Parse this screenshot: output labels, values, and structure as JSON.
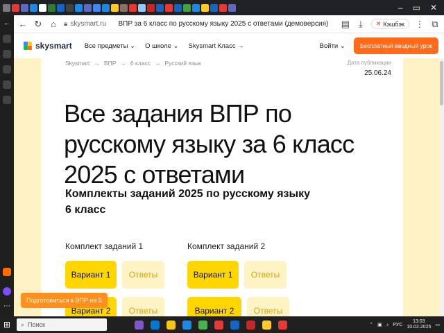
{
  "browser": {
    "url": "skysmart.ru",
    "tab_title": "ВПР за 6 класс по русскому языку 2025 с ответами (демоверсия)",
    "extension_badge": "Кэшбэк",
    "favicon_colors": [
      "#7a7a7a",
      "#e53935",
      "#5c6bc0",
      "#1e88e5",
      "#ffffff",
      "#2e7d32",
      "#1565c0",
      "#424242",
      "#1e88e5",
      "#5c6bc0",
      "#4285f4",
      "#1e88e5",
      "#ffca28",
      "#8d6e63",
      "#e53935",
      "#90caf9",
      "#c62828",
      "#1565c0",
      "#e53935",
      "#1565c0",
      "#43a047",
      "#1e88e5",
      "#ffca28",
      "#1565c0",
      "#e53935",
      "#5c6bc0"
    ]
  },
  "site": {
    "logo_text": "skysmart",
    "nav": [
      "Все предметы",
      "О школе",
      "Skysmart Класс"
    ],
    "login": "Войти",
    "cta": "Бесплатный вводный урок"
  },
  "page": {
    "breadcrumb": [
      "Skysmart",
      "ВПР",
      "6 класс",
      "Русский язык"
    ],
    "pub_label": "Дата публикации",
    "pub_date": "25.06.24",
    "title": "Все задания ВПР по русскому языку за 6 класс 2025 с ответами",
    "subtitle": "Комплекты заданий 2025 по русскому языку 6 класс",
    "sets": [
      {
        "label": "Комплект заданий 1",
        "variant1": "Вариант 1",
        "answers1": "Ответы",
        "variant2": "Вариант 2",
        "answers2": "Ответы"
      },
      {
        "label": "Комплект заданий 2",
        "variant1": "Вариант 1",
        "answers1": "Ответы",
        "variant2": "Вариант 2",
        "answers2": "Ответы"
      }
    ],
    "prep_button": "Подготовиться к ВПР на 5"
  },
  "taskbar": {
    "search_placeholder": "Поиск",
    "lang": "РУС",
    "time": "13:03",
    "date": "10.02.2025",
    "app_colors": [
      "#7e57c2",
      "#0078d4",
      "#f5c518",
      "#1e88e5",
      "#4caf50",
      "#e53935",
      "#1565c0",
      "#c62828",
      "#ffca28",
      "#e53935"
    ]
  }
}
